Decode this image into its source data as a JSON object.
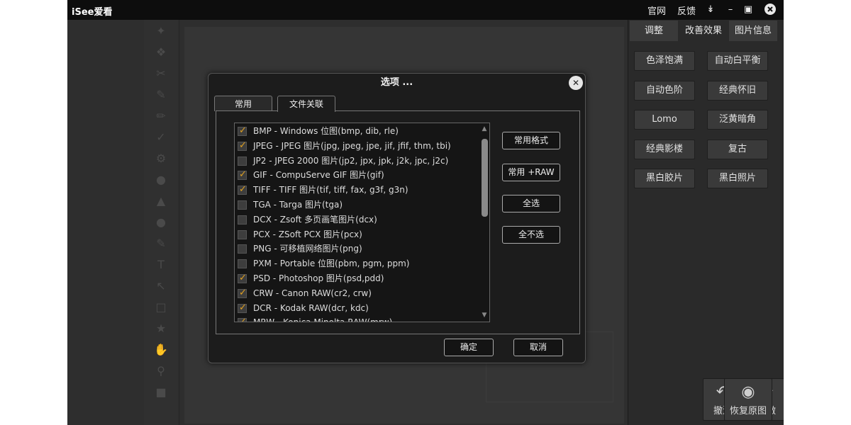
{
  "app": {
    "title": "iSee爱看",
    "links": [
      "官网",
      "反馈"
    ]
  },
  "right_panel": {
    "tabs": [
      "调整",
      "改善效果",
      "图片信息"
    ],
    "active_tab": "改善效果",
    "effects": [
      "色泽饱满",
      "自动白平衡",
      "自动色阶",
      "经典怀旧",
      "Lomo",
      "泛黄暗角",
      "经典影楼",
      "复古",
      "黑白胶片",
      "黑白照片"
    ],
    "actions": [
      {
        "label": "撤消",
        "icon": "undo-icon"
      },
      {
        "label": "重做",
        "icon": "redo-icon"
      },
      {
        "label": "恢复原图",
        "icon": "restore-icon"
      }
    ]
  },
  "dialog": {
    "title": "选项 ...",
    "tabs": [
      "常用",
      "文件关联"
    ],
    "active_tab": "文件关联",
    "formats": [
      {
        "label": "BMP - Windows 位图(bmp, dib, rle)",
        "checked": true
      },
      {
        "label": "JPEG - JPEG 图片(jpg, jpeg, jpe, jif, jfif, thm, tbi)",
        "checked": true
      },
      {
        "label": "JP2 - JPEG 2000 图片(jp2, jpx, jpk, j2k, jpc, j2c)",
        "checked": false
      },
      {
        "label": "GIF - CompuServe GIF 图片(gif)",
        "checked": true
      },
      {
        "label": "TIFF - TIFF 图片(tif, tiff, fax, g3f, g3n)",
        "checked": true
      },
      {
        "label": "TGA - Targa 图片(tga)",
        "checked": false
      },
      {
        "label": "DCX - Zsoft 多页画笔图片(dcx)",
        "checked": false
      },
      {
        "label": "PCX - ZSoft PCX 图片(pcx)",
        "checked": false
      },
      {
        "label": "PNG - 可移植网络图片(png)",
        "checked": false
      },
      {
        "label": "PXM - Portable 位图(pbm, pgm, ppm)",
        "checked": false
      },
      {
        "label": "PSD - Photoshop 图片(psd,pdd)",
        "checked": true
      },
      {
        "label": "CRW - Canon RAW(cr2, crw)",
        "checked": true
      },
      {
        "label": "DCR - Kodak RAW(dcr, kdc)",
        "checked": true
      },
      {
        "label": "MRW - Konica Minolta RAW(mrw)",
        "checked": true
      }
    ],
    "option_buttons": [
      "常用格式",
      "常用 +RAW",
      "全选",
      "全不选"
    ],
    "ok_label": "确定",
    "cancel_label": "取消"
  },
  "colors": {
    "check_accent": "#e0a020",
    "titlebar": "#0d0d0d",
    "panel": "#2a2a2a"
  }
}
